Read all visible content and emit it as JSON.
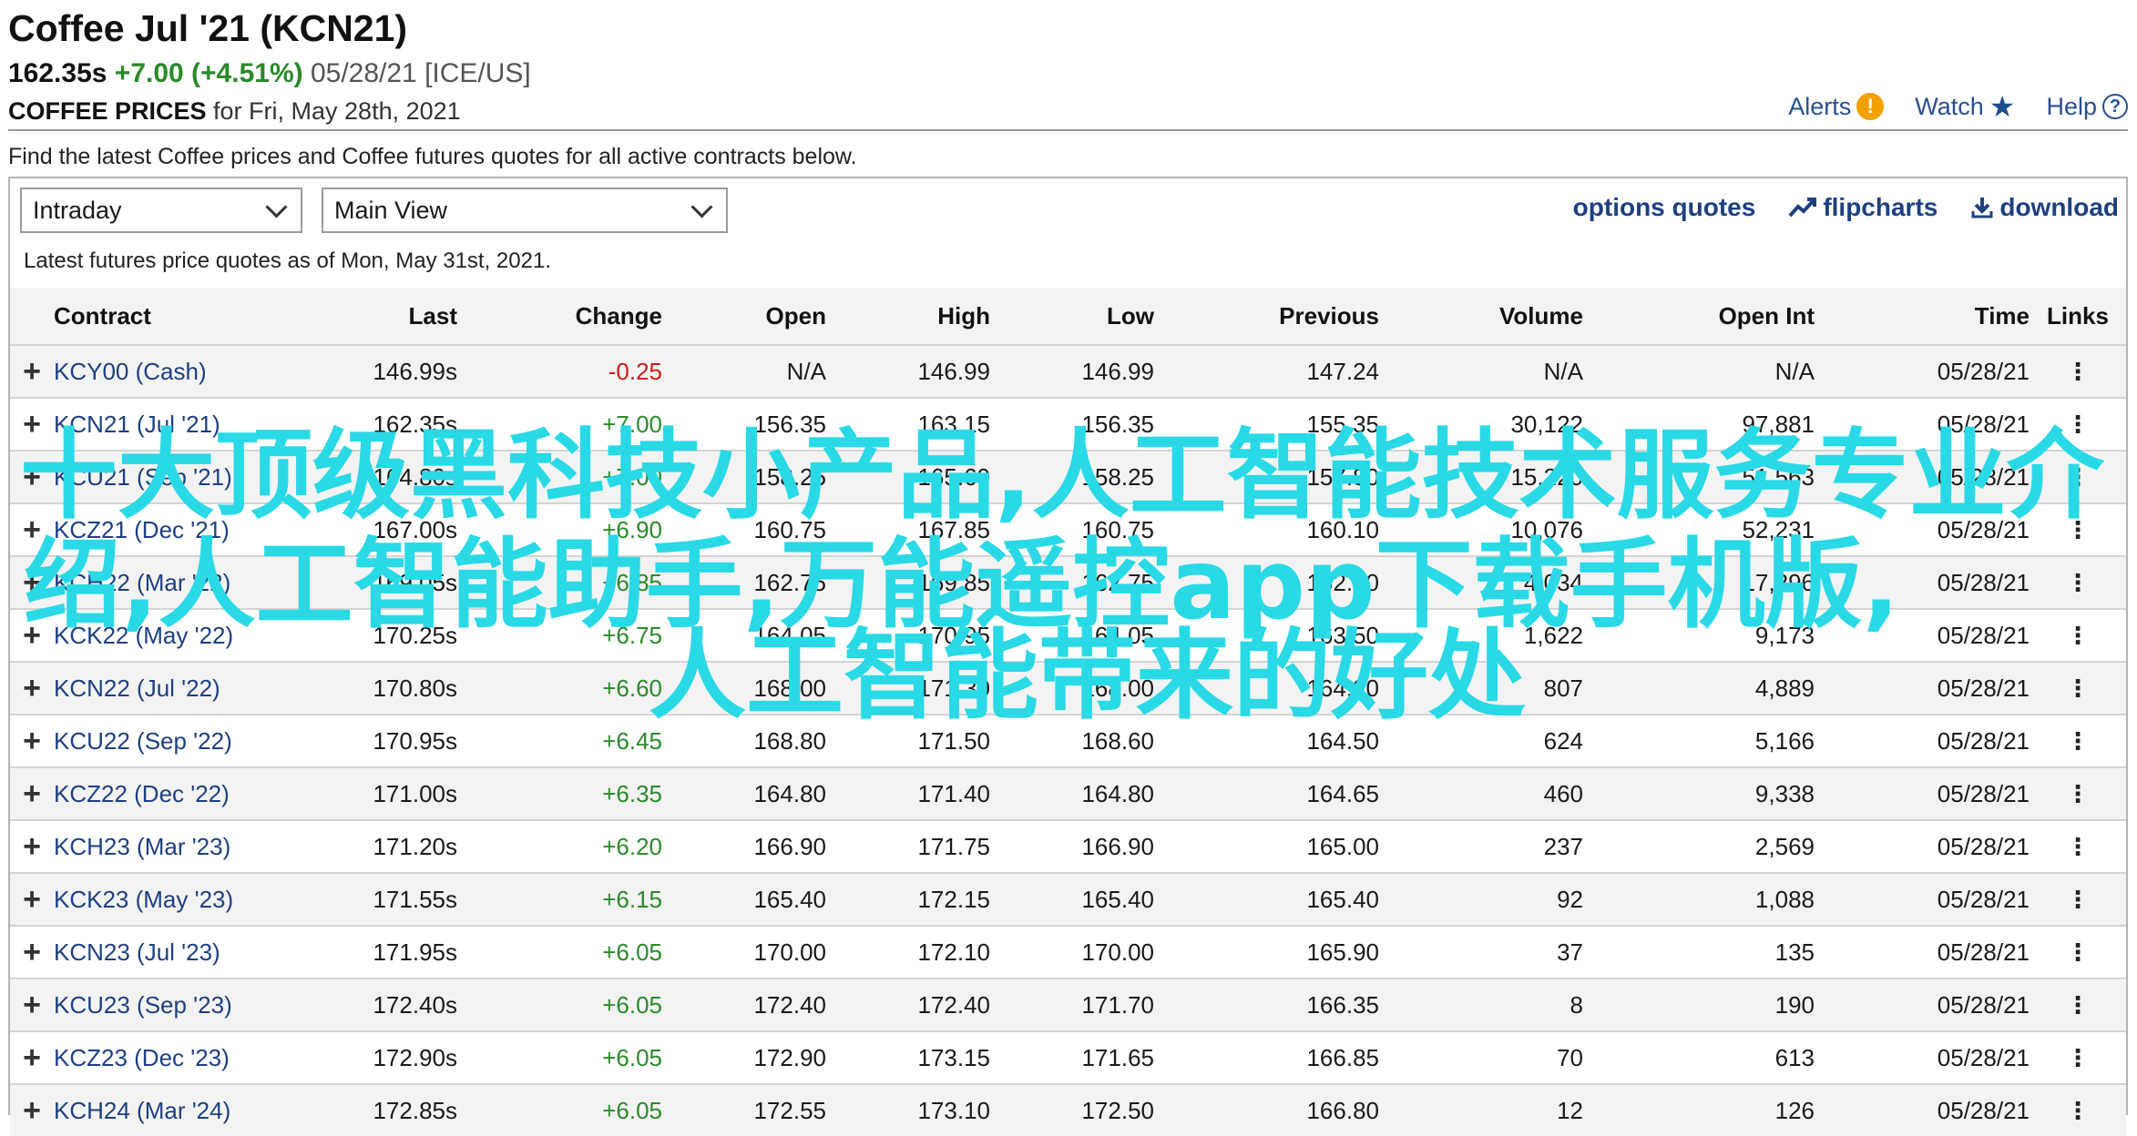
{
  "header": {
    "title": "Coffee Jul '21 (KCN21)",
    "price": "162.35s",
    "change": "+7.00 (+4.51%)",
    "date_exchange": "05/28/21 [ICE/US]",
    "subtitle_bold": "COFFEE PRICES",
    "subtitle_rest": " for Fri, May 28th, 2021"
  },
  "toplinks": {
    "alerts": "Alerts",
    "alerts_badge": "!",
    "watch": "Watch",
    "help": "Help",
    "help_badge": "?"
  },
  "intro": "Find the latest Coffee prices and Coffee futures quotes for all active contracts below.",
  "controls": {
    "period_select": "Intraday",
    "view_select": "Main View",
    "options_quotes": "options quotes",
    "flipcharts": "flipcharts",
    "download": "download"
  },
  "asof": "Latest futures price quotes as of Mon, May 31st, 2021.",
  "table": {
    "headers": [
      "Contract",
      "Last",
      "Change",
      "Open",
      "High",
      "Low",
      "Previous",
      "Volume",
      "Open Int",
      "Time",
      "Links"
    ],
    "rows": [
      {
        "contract": "KCY00 (Cash)",
        "last": "146.99s",
        "change": "-0.25",
        "dir": "down",
        "open": "N/A",
        "high": "146.99",
        "low": "146.99",
        "previous": "147.24",
        "volume": "N/A",
        "openint": "N/A",
        "time": "05/28/21"
      },
      {
        "contract": "KCN21 (Jul '21)",
        "last": "162.35s",
        "change": "+7.00",
        "dir": "up",
        "open": "156.35",
        "high": "163.15",
        "low": "156.35",
        "previous": "155.35",
        "volume": "30,122",
        "openint": "97,881",
        "time": "05/28/21"
      },
      {
        "contract": "KCU21 (Sep '21)",
        "last": "164.80s",
        "change": "+7.00",
        "dir": "up",
        "open": "158.25",
        "high": "165.60",
        "low": "158.25",
        "previous": "157.80",
        "volume": "15,220",
        "openint": "51,563",
        "time": "05/28/21"
      },
      {
        "contract": "KCZ21 (Dec '21)",
        "last": "167.00s",
        "change": "+6.90",
        "dir": "up",
        "open": "160.75",
        "high": "167.85",
        "low": "160.75",
        "previous": "160.10",
        "volume": "10,076",
        "openint": "52,231",
        "time": "05/28/21"
      },
      {
        "contract": "KCH22 (Mar '22)",
        "last": "169.05s",
        "change": "+6.85",
        "dir": "up",
        "open": "162.75",
        "high": "169.85",
        "low": "162.75",
        "previous": "162.20",
        "volume": "4,034",
        "openint": "17,296",
        "time": "05/28/21"
      },
      {
        "contract": "KCK22 (May '22)",
        "last": "170.25s",
        "change": "+6.75",
        "dir": "up",
        "open": "164.05",
        "high": "170.95",
        "low": "164.05",
        "previous": "163.50",
        "volume": "1,622",
        "openint": "9,173",
        "time": "05/28/21"
      },
      {
        "contract": "KCN22 (Jul '22)",
        "last": "170.80s",
        "change": "+6.60",
        "dir": "up",
        "open": "168.00",
        "high": "171.30",
        "low": "168.00",
        "previous": "164.20",
        "volume": "807",
        "openint": "4,889",
        "time": "05/28/21"
      },
      {
        "contract": "KCU22 (Sep '22)",
        "last": "170.95s",
        "change": "+6.45",
        "dir": "up",
        "open": "168.80",
        "high": "171.50",
        "low": "168.60",
        "previous": "164.50",
        "volume": "624",
        "openint": "5,166",
        "time": "05/28/21"
      },
      {
        "contract": "KCZ22 (Dec '22)",
        "last": "171.00s",
        "change": "+6.35",
        "dir": "up",
        "open": "164.80",
        "high": "171.40",
        "low": "164.80",
        "previous": "164.65",
        "volume": "460",
        "openint": "9,338",
        "time": "05/28/21"
      },
      {
        "contract": "KCH23 (Mar '23)",
        "last": "171.20s",
        "change": "+6.20",
        "dir": "up",
        "open": "166.90",
        "high": "171.75",
        "low": "166.90",
        "previous": "165.00",
        "volume": "237",
        "openint": "2,569",
        "time": "05/28/21"
      },
      {
        "contract": "KCK23 (May '23)",
        "last": "171.55s",
        "change": "+6.15",
        "dir": "up",
        "open": "165.40",
        "high": "172.15",
        "low": "165.40",
        "previous": "165.40",
        "volume": "92",
        "openint": "1,088",
        "time": "05/28/21"
      },
      {
        "contract": "KCN23 (Jul '23)",
        "last": "171.95s",
        "change": "+6.05",
        "dir": "up",
        "open": "170.00",
        "high": "172.10",
        "low": "170.00",
        "previous": "165.90",
        "volume": "37",
        "openint": "135",
        "time": "05/28/21"
      },
      {
        "contract": "KCU23 (Sep '23)",
        "last": "172.40s",
        "change": "+6.05",
        "dir": "up",
        "open": "172.40",
        "high": "172.40",
        "low": "171.70",
        "previous": "166.35",
        "volume": "8",
        "openint": "190",
        "time": "05/28/21"
      },
      {
        "contract": "KCZ23 (Dec '23)",
        "last": "172.90s",
        "change": "+6.05",
        "dir": "up",
        "open": "172.90",
        "high": "173.15",
        "low": "171.65",
        "previous": "166.85",
        "volume": "70",
        "openint": "613",
        "time": "05/28/21"
      },
      {
        "contract": "KCH24 (Mar '24)",
        "last": "172.85s",
        "change": "+6.05",
        "dir": "up",
        "open": "172.55",
        "high": "173.10",
        "low": "172.50",
        "previous": "166.80",
        "volume": "12",
        "openint": "126",
        "time": "05/28/21"
      }
    ]
  },
  "overlay": {
    "line1": "十大顶级黑科技小产品,人工智能技术服务专业介",
    "line2": "绍,人工智能助手,万能遥控app下载手机版,",
    "line3": "人工智能带来的好处"
  },
  "colors": {
    "link": "#1d4080",
    "up": "#2a8a2a",
    "down": "#d11a1a",
    "overlay": "#2ad9e6",
    "alert": "#f2a100"
  }
}
